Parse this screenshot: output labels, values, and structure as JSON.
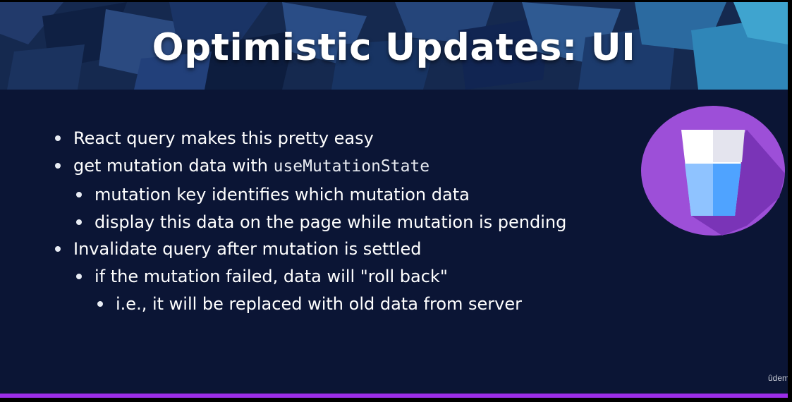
{
  "slide": {
    "title": "Optimistic Updates: UI",
    "bullets": [
      {
        "text": "React query makes this pretty easy"
      },
      {
        "text": "get mutation data with ",
        "code": "useMutationState"
      },
      {
        "text": "mutation key identifies which mutation data"
      },
      {
        "text": "display this data on the page while mutation is pending"
      },
      {
        "text": "Invalidate query after mutation is settled"
      },
      {
        "text": "if the mutation failed, data will \"roll back\""
      },
      {
        "text": "i.e., it will be replaced with old data from server"
      }
    ]
  },
  "watermark": "ûdemy",
  "icons": {
    "logo": "react-query-glass-icon"
  },
  "colors": {
    "background": "#0b1535",
    "accent_line": "#9b2de8",
    "logo_circle": "#9d4fd8",
    "logo_water_light": "#8fc3ff",
    "logo_water_dark": "#4fa3ff"
  }
}
